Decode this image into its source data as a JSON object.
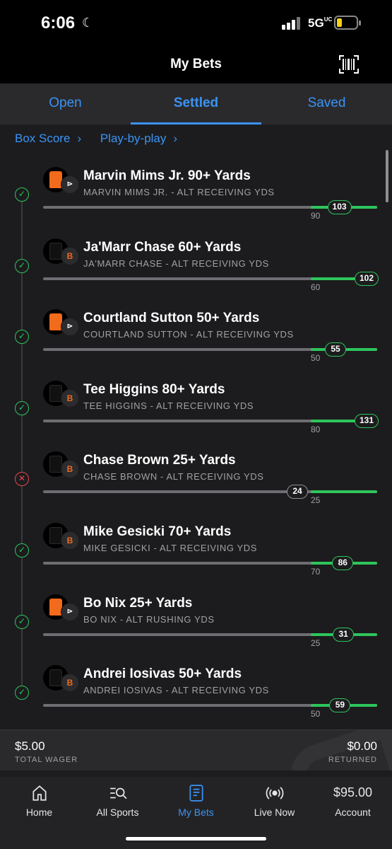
{
  "status_bar": {
    "time": "6:06",
    "network": "5G",
    "network_suffix": "UC"
  },
  "header": {
    "title": "My Bets"
  },
  "tabs": [
    {
      "label": "Open",
      "active": false
    },
    {
      "label": "Settled",
      "active": true
    },
    {
      "label": "Saved",
      "active": false
    }
  ],
  "links": {
    "box_score": "Box Score",
    "play_by_play": "Play-by-play"
  },
  "legs": [
    {
      "title": "Marvin Mims Jr. 90+ Yards",
      "market": "MARVIN MIMS JR. - ALT RECEIVING YDS",
      "target": "90",
      "actual": "103",
      "won": true,
      "team": "broncos"
    },
    {
      "title": "Ja'Marr Chase 60+ Yards",
      "market": "JA'MARR CHASE - ALT RECEIVING YDS",
      "target": "60",
      "actual": "102",
      "won": true,
      "team": "bengals"
    },
    {
      "title": "Courtland Sutton 50+ Yards",
      "market": "COURTLAND SUTTON - ALT RECEIVING YDS",
      "target": "50",
      "actual": "55",
      "won": true,
      "team": "broncos"
    },
    {
      "title": "Tee Higgins 80+ Yards",
      "market": "TEE HIGGINS - ALT RECEIVING YDS",
      "target": "80",
      "actual": "131",
      "won": true,
      "team": "bengals"
    },
    {
      "title": "Chase Brown 25+ Yards",
      "market": "CHASE BROWN - ALT RECEIVING YDS",
      "target": "25",
      "actual": "24",
      "won": false,
      "team": "bengals"
    },
    {
      "title": "Mike Gesicki 70+ Yards",
      "market": "MIKE GESICKI - ALT RECEIVING YDS",
      "target": "70",
      "actual": "86",
      "won": true,
      "team": "bengals"
    },
    {
      "title": "Bo Nix 25+ Yards",
      "market": "BO NIX - ALT RUSHING YDS",
      "target": "25",
      "actual": "31",
      "won": true,
      "team": "broncos"
    },
    {
      "title": "Andrei Iosivas 50+ Yards",
      "market": "ANDREI IOSIVAS - ALT RECEIVING YDS",
      "target": "50",
      "actual": "59",
      "won": true,
      "team": "bengals"
    }
  ],
  "wager": {
    "total_wager": "$5.00",
    "total_wager_label": "TOTAL WAGER",
    "returned": "$0.00",
    "returned_label": "RETURNED"
  },
  "nav": [
    {
      "label": "Home",
      "icon": "home-icon"
    },
    {
      "label": "All Sports",
      "icon": "search-list-icon"
    },
    {
      "label": "My Bets",
      "icon": "betslip-icon",
      "active": true
    },
    {
      "label": "Live Now",
      "icon": "live-icon"
    },
    {
      "label": "Account",
      "balance": "$95.00"
    }
  ],
  "colors": {
    "accent": "#3b93f5",
    "win": "#2ec55c",
    "loss": "#e5484d",
    "broncos_orange": "#f26a1b"
  }
}
